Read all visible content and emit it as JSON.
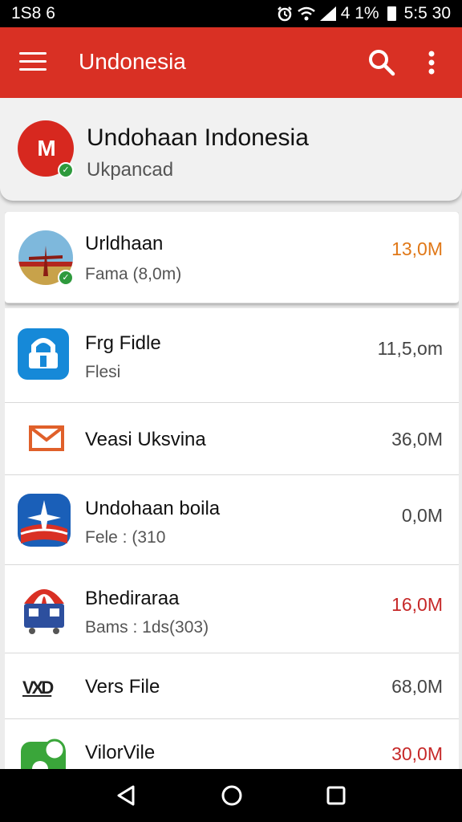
{
  "status_bar": {
    "time_left": "1S8 6",
    "right_text": "4 1%",
    "clock": "5:5 30",
    "icons": [
      "alarm-icon",
      "wifi-icon",
      "signal-icon",
      "battery-icon"
    ]
  },
  "app_bar": {
    "title": "Undonesia",
    "color": "#d93024",
    "icons": [
      "menu-icon",
      "search-icon",
      "more-vert-icon"
    ]
  },
  "account": {
    "name": "Undohaan Indonesia",
    "subtitle": "Ukpancad",
    "avatar_letters": "M"
  },
  "files": [
    {
      "title": "Urldhaan",
      "subtitle": "Fama (8,0m)",
      "size": "13,0M",
      "size_color": "#e07818",
      "icon": "windmill-photo-icon"
    },
    {
      "title": "Frg Fidle",
      "subtitle": "Flesi",
      "size": "11,5,om",
      "size_color": "#444444",
      "icon": "lock-app-icon"
    },
    {
      "title": "Veasi Uksvina",
      "subtitle": "",
      "size": "36,0M",
      "size_color": "#444444",
      "icon": "mail-icon"
    },
    {
      "title": "Undohaan boila",
      "subtitle": "Fele : (310",
      "size": "0,0M",
      "size_color": "#444444",
      "icon": "airplane-app-icon"
    },
    {
      "title": "Bhediraraa",
      "subtitle": "Bams : 1ds(303)",
      "size": "16,0M",
      "size_color": "#c62828",
      "icon": "shop-icon"
    },
    {
      "title": "Vers File",
      "subtitle": "",
      "size": "68,0M",
      "size_color": "#444444",
      "icon": "vxd-logo-icon",
      "logo_text": "VXD"
    },
    {
      "title": "VilorVile",
      "subtitle": "",
      "size": "30,0M",
      "size_color": "#c62828",
      "icon": "green-app-icon"
    }
  ],
  "nav_bar": {
    "icons": [
      "back-icon",
      "home-icon",
      "recents-icon"
    ]
  }
}
